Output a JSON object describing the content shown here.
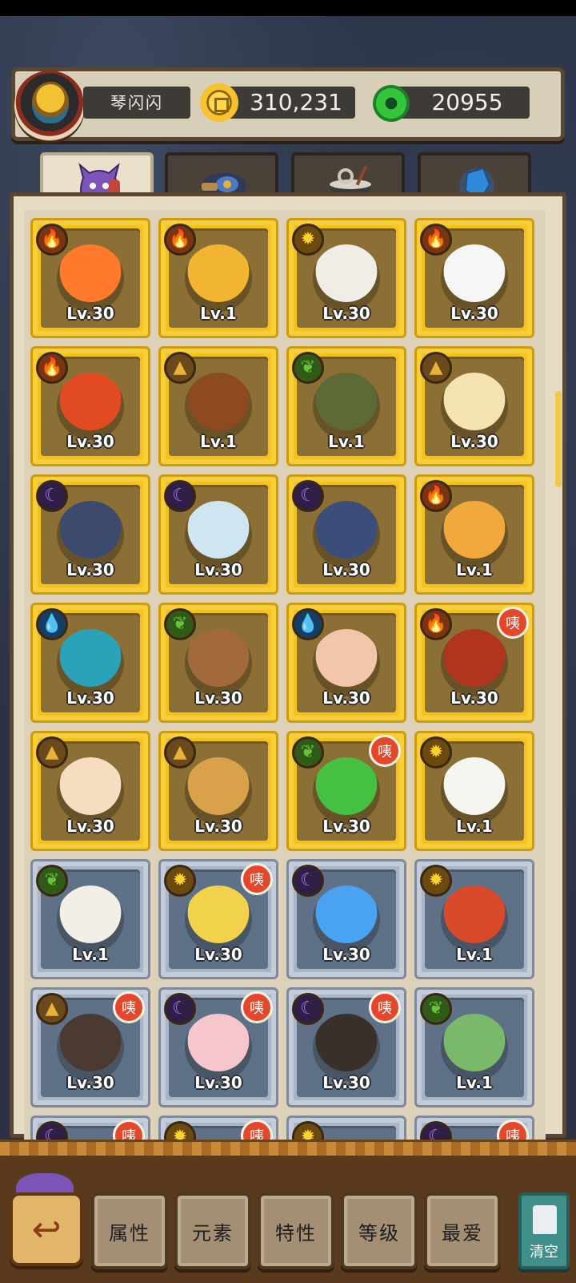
{
  "header": {
    "player_name": "琴闪闪",
    "coins": "310,231",
    "gems": "20955"
  },
  "tabs": [
    {
      "name": "monsters",
      "icon": "purple-monster-icon",
      "active": true
    },
    {
      "name": "artifacts",
      "icon": "feather-scroll-icon",
      "active": false
    },
    {
      "name": "food",
      "icon": "noodle-bowl-icon",
      "active": false
    },
    {
      "name": "crystals",
      "icon": "blue-crystal-icon",
      "active": false
    }
  ],
  "badge_label": "咦",
  "cards": [
    {
      "level": "Lv.30",
      "element": "fire",
      "frame": "gold",
      "new": false,
      "color": "#ff7a2a"
    },
    {
      "level": "Lv.1",
      "element": "fire",
      "frame": "gold",
      "new": false,
      "color": "#f2b531"
    },
    {
      "level": "Lv.30",
      "element": "sun",
      "frame": "gold",
      "new": false,
      "color": "#f0ece6"
    },
    {
      "level": "Lv.30",
      "element": "fire",
      "frame": "gold",
      "new": false,
      "color": "#f6f6f6"
    },
    {
      "level": "Lv.30",
      "element": "fire",
      "frame": "gold",
      "new": false,
      "color": "#e24b22"
    },
    {
      "level": "Lv.1",
      "element": "earth",
      "frame": "gold",
      "new": false,
      "color": "#8c4a1e"
    },
    {
      "level": "Lv.1",
      "element": "leaf",
      "frame": "gold",
      "new": false,
      "color": "#5e6a36"
    },
    {
      "level": "Lv.30",
      "element": "earth",
      "frame": "gold",
      "new": false,
      "color": "#f4e2b0"
    },
    {
      "level": "Lv.30",
      "element": "moon",
      "frame": "gold",
      "new": false,
      "color": "#3c4a6e"
    },
    {
      "level": "Lv.30",
      "element": "moon",
      "frame": "gold",
      "new": false,
      "color": "#cfe6f2"
    },
    {
      "level": "Lv.30",
      "element": "moon",
      "frame": "gold",
      "new": false,
      "color": "#3b4e7a"
    },
    {
      "level": "Lv.1",
      "element": "fire",
      "frame": "gold",
      "new": false,
      "color": "#f2a83a"
    },
    {
      "level": "Lv.30",
      "element": "water",
      "frame": "gold",
      "new": false,
      "color": "#2aa2b8"
    },
    {
      "level": "Lv.30",
      "element": "leaf",
      "frame": "gold",
      "new": false,
      "color": "#a26a3a"
    },
    {
      "level": "Lv.30",
      "element": "water",
      "frame": "gold",
      "new": false,
      "color": "#f2c6a8"
    },
    {
      "level": "Lv.30",
      "element": "fire",
      "frame": "gold",
      "new": true,
      "color": "#b0341e"
    },
    {
      "level": "Lv.30",
      "element": "earth",
      "frame": "gold",
      "new": false,
      "color": "#f6dcc0"
    },
    {
      "level": "Lv.30",
      "element": "earth",
      "frame": "gold",
      "new": false,
      "color": "#d9a24a"
    },
    {
      "level": "Lv.30",
      "element": "leaf",
      "frame": "gold",
      "new": true,
      "color": "#46c040"
    },
    {
      "level": "Lv.1",
      "element": "sun",
      "frame": "gold",
      "new": false,
      "color": "#f6f6f0"
    },
    {
      "level": "Lv.1",
      "element": "leaf",
      "frame": "silver",
      "new": false,
      "color": "#f2efe6"
    },
    {
      "level": "Lv.30",
      "element": "sun",
      "frame": "silver",
      "new": true,
      "color": "#f2d24a"
    },
    {
      "level": "Lv.30",
      "element": "moon",
      "frame": "silver",
      "new": false,
      "color": "#4aa2f2"
    },
    {
      "level": "Lv.1",
      "element": "sun",
      "frame": "silver",
      "new": false,
      "color": "#d94a2a"
    },
    {
      "level": "Lv.30",
      "element": "earth",
      "frame": "silver",
      "new": true,
      "color": "#4a3a32"
    },
    {
      "level": "Lv.30",
      "element": "moon",
      "frame": "silver",
      "new": true,
      "color": "#f6c6cc"
    },
    {
      "level": "Lv.30",
      "element": "moon",
      "frame": "silver",
      "new": true,
      "color": "#3a302a"
    },
    {
      "level": "Lv.1",
      "element": "leaf",
      "frame": "silver",
      "new": false,
      "color": "#7ab86a"
    },
    {
      "level": "",
      "element": "moon",
      "frame": "silver",
      "new": true,
      "color": "#5f7187"
    },
    {
      "level": "",
      "element": "sun",
      "frame": "silver",
      "new": true,
      "color": "#5f7187"
    },
    {
      "level": "",
      "element": "sun",
      "frame": "silver",
      "new": false,
      "color": "#5f7187"
    },
    {
      "level": "",
      "element": "moon",
      "frame": "silver",
      "new": true,
      "color": "#5f7187"
    }
  ],
  "element_glyphs": {
    "fire": "🔥",
    "sun": "✹",
    "earth": "▲",
    "leaf": "❦",
    "moon": "☾",
    "water": "💧"
  },
  "filters": {
    "attribute": "属性",
    "element": "元素",
    "trait": "特性",
    "level": "等级",
    "favorite": "最爱"
  },
  "clear_label": "清空",
  "colors": {
    "gold_frame": "#f4c219",
    "silver_frame": "#a8b5c6",
    "badge": "#e4482a",
    "accent_wood": "#5a3a1c"
  }
}
